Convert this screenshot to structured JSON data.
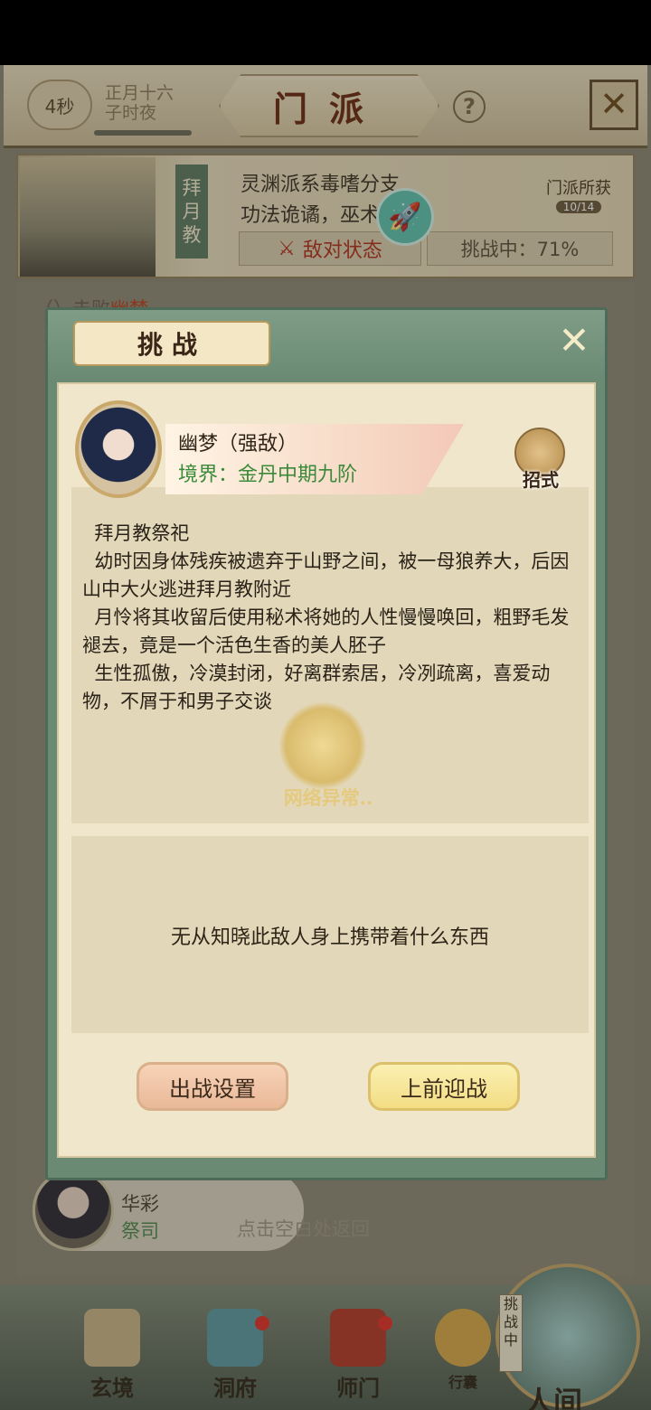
{
  "header": {
    "timer": "4秒",
    "date_line1": "正月十六",
    "date_line2": "子时夜",
    "title": "门派",
    "help": "?"
  },
  "sect": {
    "name_tag": [
      "拜",
      "月",
      "教"
    ],
    "desc_line1": "灵渊派系毒嗜分支",
    "desc_line2": "功法诡谲，巫术",
    "enemy_status": "敌对状态",
    "challenge_progress": "挑战中：71%",
    "gain_label": "门派所获",
    "gain_count": "10/14"
  },
  "behind_row": {
    "prefix": "（",
    "text": "）击败",
    "highlight": "幽梦"
  },
  "member": {
    "name": "华彩",
    "role": "祭司"
  },
  "dismiss_hint": "点击空白处返回",
  "bottom_nav": {
    "items": [
      {
        "label": "玄境"
      },
      {
        "label": "洞府"
      },
      {
        "label": "师门"
      },
      {
        "label": "行囊"
      }
    ],
    "challenge_tag": "挑战中",
    "main_label": "人间"
  },
  "modal": {
    "title": "挑战",
    "enemy_name": "幽梦（强敌）",
    "enemy_realm": "境界：金丹中期九阶",
    "moves_label": "招式",
    "desc_lines": [
      "  拜月教祭祀",
      "  幼时因身体残疾被遗弃于山野之间，被一母狼养大，后因山中大火逃进拜月教附近",
      "  月怜将其收留后使用秘术将她的人性慢慢唤回，粗野毛发褪去，竟是一个活色生香的美人胚子",
      "  生性孤傲，冷漠封闭，好离群索居，冷冽疏离，喜爱动物，不屑于和男子交谈"
    ],
    "loading_text": "网络异常..",
    "loot_text": "无从知晓此敌人身上携带着什么东西",
    "btn_setup": "出战设置",
    "btn_fight": "上前迎战"
  },
  "colors": {
    "modal_frame": "#6b8a74",
    "parchment": "#efe6cc",
    "enemy_red": "#b2321c",
    "realm_green": "#3a8a3a"
  }
}
